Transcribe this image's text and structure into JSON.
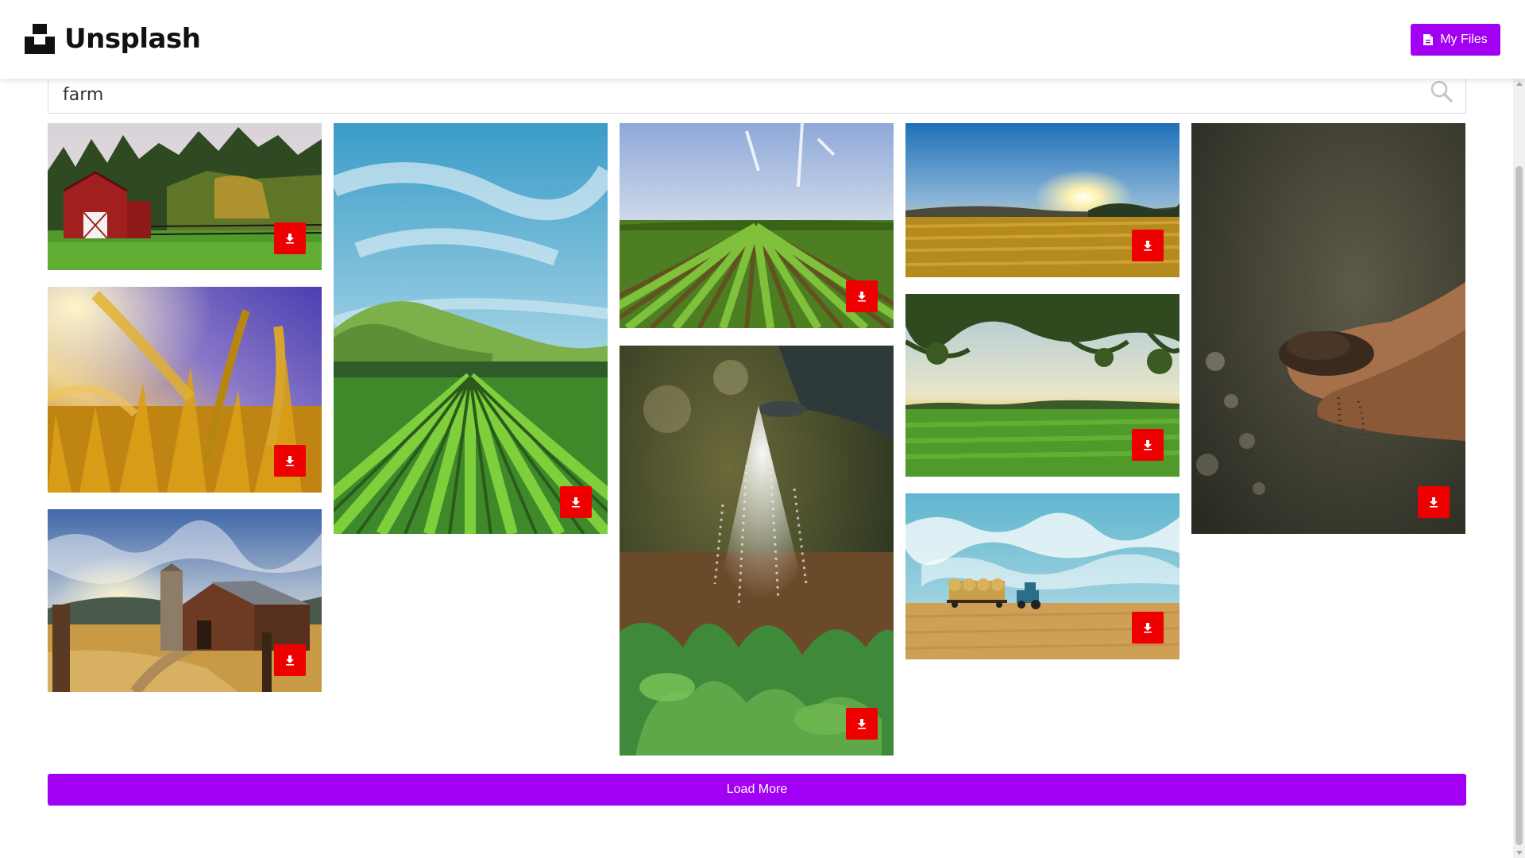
{
  "theme": {
    "accent": "#a100f2",
    "download_button_color": "#ee0000"
  },
  "header": {
    "brand_name": "Unsplash",
    "brand_icon": "unsplash-logo-icon",
    "my_files_label": "My Files",
    "my_files_icon": "file-icon"
  },
  "search": {
    "value": "farm",
    "icon": "search-icon"
  },
  "gallery": {
    "columns": 5,
    "download_icon": "download-icon",
    "photos": [
      {
        "id": "red-barn",
        "description": "red barn with forest"
      },
      {
        "id": "vineyard-rows",
        "description": "vineyard rows below hills"
      },
      {
        "id": "crop-field",
        "description": "green crop field rows"
      },
      {
        "id": "sunset-field",
        "description": "sunset over golden field"
      },
      {
        "id": "soil-hands",
        "description": "hands holding soil"
      },
      {
        "id": "wheat-closeup",
        "description": "golden wheat close-up"
      },
      {
        "id": "watering-plants",
        "description": "watering can over seedlings"
      },
      {
        "id": "green-field-tree",
        "description": "green field under tree branches"
      },
      {
        "id": "old-barn-silo",
        "description": "old barn and silo at sunset"
      },
      {
        "id": "hay-tractor",
        "description": "tractor hauling hay bales"
      }
    ]
  },
  "footer": {
    "load_more_label": "Load More"
  }
}
